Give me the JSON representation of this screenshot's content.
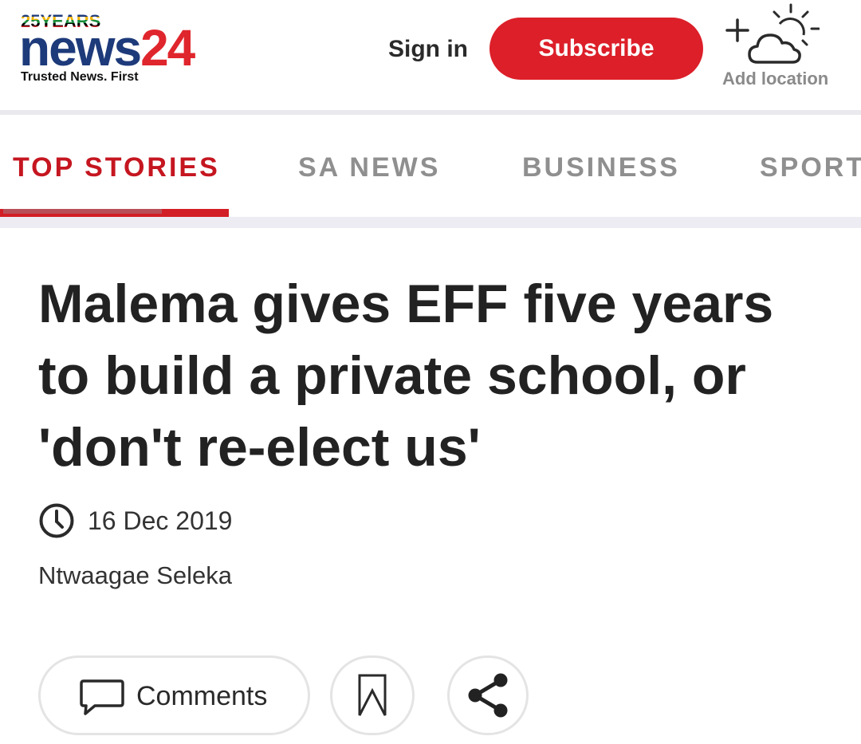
{
  "header": {
    "logo": {
      "years_text": "25YEARS",
      "brand_text": "news",
      "brand_number": "24",
      "tagline": "Trusted News. First"
    },
    "sign_in_label": "Sign in",
    "subscribe_label": "Subscribe",
    "weather": {
      "icon": "add-weather-icon",
      "label": "Add location"
    }
  },
  "nav": {
    "tabs": [
      {
        "label": "TOP STORIES",
        "active": true
      },
      {
        "label": "SA NEWS",
        "active": false
      },
      {
        "label": "BUSINESS",
        "active": false
      },
      {
        "label": "SPORT",
        "active": false
      }
    ]
  },
  "article": {
    "headline": "Malema gives EFF five years to build a private school, or 'don't re-elect us'",
    "date": "16 Dec 2019",
    "author": "Ntwaagae Seleka",
    "actions": {
      "comments_label": "Comments",
      "comments_icon": "comment-icon",
      "bookmark_icon": "bookmark-icon",
      "share_icon": "share-icon"
    }
  },
  "colors": {
    "brand_blue": "#1d3a7a",
    "brand_red": "#e0262d",
    "subscribe_red": "#dc1f29",
    "active_tab": "#c51620",
    "inactive_tab": "#8f8f8f",
    "text_dark": "#222222"
  }
}
